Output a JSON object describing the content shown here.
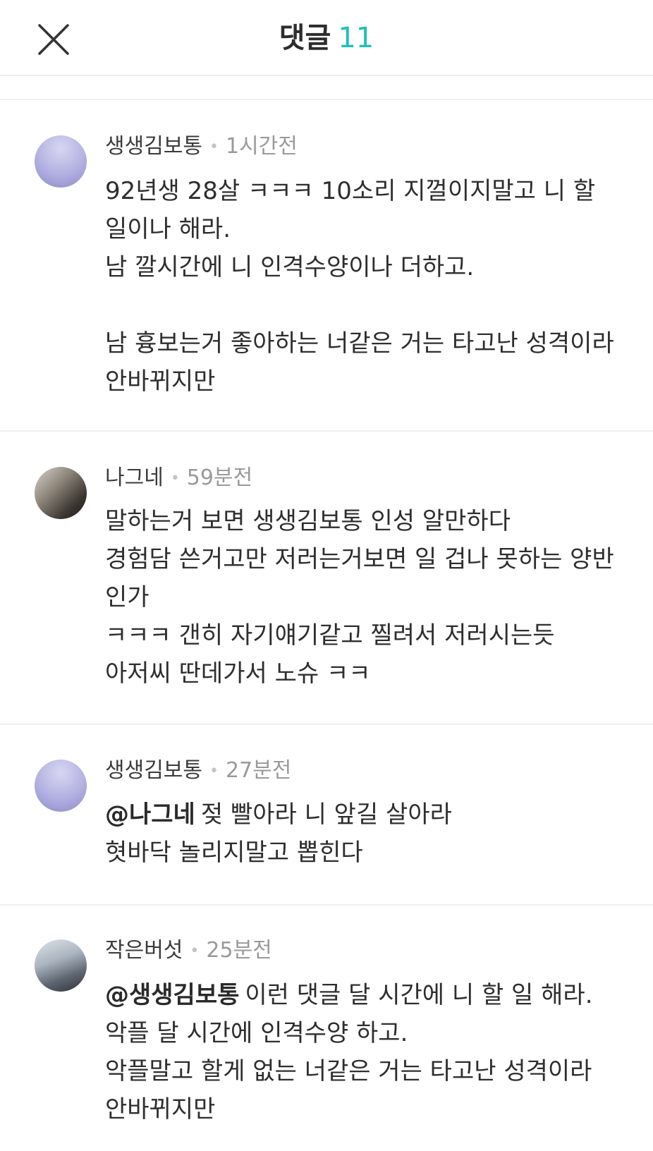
{
  "header": {
    "title": "댓글",
    "count": "11",
    "count_color": "#1fbfb8",
    "close_icon": "close-icon"
  },
  "comments": [
    {
      "author": "생생김보통",
      "time": "1시간전",
      "avatar": "default-avatar",
      "lines": [
        "92년생  28살  ㅋㅋㅋ  10소리 지껄이지말고 니 할",
        "일이나 해라.",
        "남 깔시간에  니 인격수양이나 더하고.",
        "",
        "남 흉보는거 좋아하는 너같은 거는 타고난 성격이라",
        "안바뀌지만"
      ]
    },
    {
      "author": "나그네",
      "time": "59분전",
      "avatar": "photo-avatar",
      "lines": [
        "말하는거 보면 생생김보통 인성 알만하다",
        "경험담 쓴거고만 저러는거보면 일 겁나 못하는 양반",
        "인가",
        "ㅋㅋㅋ 갠히 자기얘기같고 찔려서 저러시는듯",
        "아저씨 딴데가서 노슈 ㅋㅋ"
      ]
    },
    {
      "author": "생생김보통",
      "time": "27분전",
      "avatar": "default-avatar",
      "mention": "@나그네",
      "lines": [
        "젖 빨아라  니 앞길 살아라",
        "혓바닥 놀리지말고 뽑힌다"
      ]
    },
    {
      "author": "작은버섯",
      "time": "25분전",
      "avatar": "photo-avatar",
      "mention": "@생생김보통",
      "lines": [
        "이런 댓글 달 시간에 니 할 일 해라.",
        "악플 달 시간에 인격수양 하고.",
        "악플말고 할게 없는 너같은 거는 타고난 성격이라",
        "안바뀌지만"
      ]
    }
  ]
}
